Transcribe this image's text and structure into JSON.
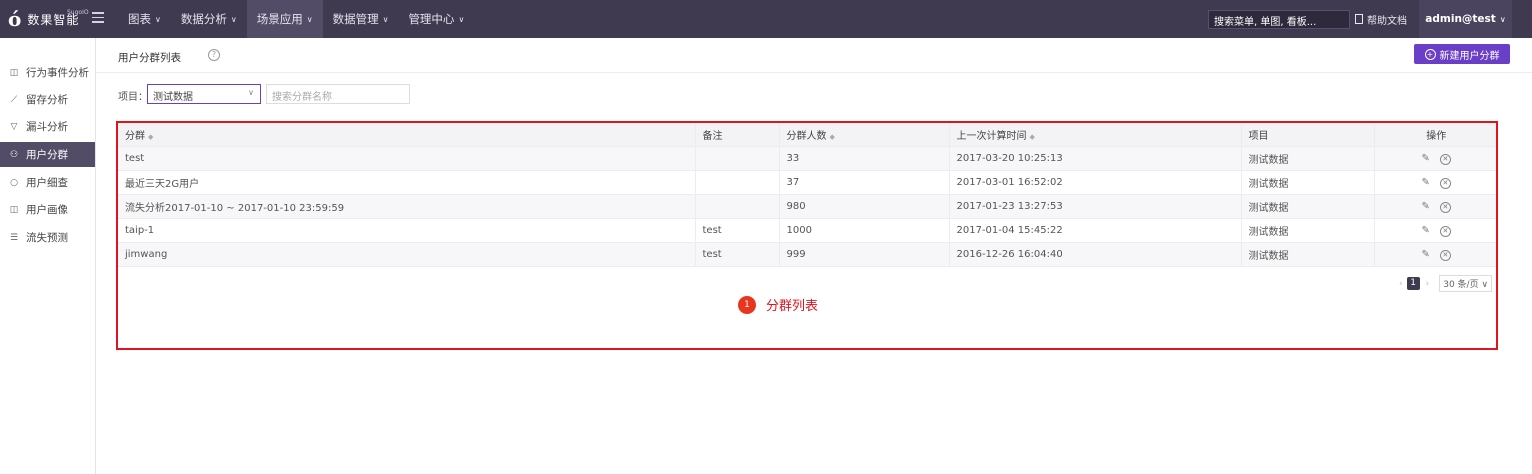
{
  "brand": {
    "mark": "ó",
    "name": "数果智能",
    "sup": "SugoIO"
  },
  "nav": {
    "items": [
      {
        "label": "图表",
        "active": false
      },
      {
        "label": "数据分析",
        "active": false
      },
      {
        "label": "场景应用",
        "active": true
      },
      {
        "label": "数据管理",
        "active": false
      },
      {
        "label": "管理中心",
        "active": false
      }
    ]
  },
  "header": {
    "search_placeholder": "搜索菜单, 单图, 看板...",
    "help": "帮助文档",
    "user": "admin@test"
  },
  "sidebar": {
    "items": [
      {
        "label": "行为事件分析",
        "icon": "event-icon",
        "glyph": "◫"
      },
      {
        "label": "留存分析",
        "icon": "chart-icon",
        "glyph": "⟋"
      },
      {
        "label": "漏斗分析",
        "icon": "funnel-icon",
        "glyph": "▽"
      },
      {
        "label": "用户分群",
        "icon": "users-icon",
        "glyph": "⚇",
        "active": true
      },
      {
        "label": "用户细查",
        "icon": "search-icon",
        "glyph": "○"
      },
      {
        "label": "用户画像",
        "icon": "portrait-icon",
        "glyph": "◫"
      },
      {
        "label": "流失预测",
        "icon": "list-icon",
        "glyph": "☰"
      }
    ]
  },
  "page": {
    "title": "用户分群列表",
    "help": "?",
    "new_button": "新建用户分群"
  },
  "filter": {
    "label": "项目：",
    "project_value": "测试数据",
    "name_placeholder": "搜索分群名称"
  },
  "table": {
    "headers": [
      "分群",
      "备注",
      "分群人数",
      "上一次计算时间",
      "项目",
      "操作"
    ],
    "rows": [
      {
        "name": "test",
        "note": "",
        "count": "33",
        "time": "2017-03-20 10:25:13",
        "project": "测试数据"
      },
      {
        "name": "最近三天2G用户",
        "note": "",
        "count": "37",
        "time": "2017-03-01 16:52:02",
        "project": "测试数据"
      },
      {
        "name": "流失分析2017-01-10 ~ 2017-01-10 23:59:59",
        "note": "",
        "count": "980",
        "time": "2017-01-23 13:27:53",
        "project": "测试数据"
      },
      {
        "name": "taip-1",
        "note": "test",
        "count": "1000",
        "time": "2017-01-04 15:45:22",
        "project": "测试数据"
      },
      {
        "name": "jimwang",
        "note": "test",
        "count": "999",
        "time": "2016-12-26 16:04:40",
        "project": "测试数据"
      }
    ]
  },
  "pager": {
    "prev": "‹",
    "current": "1",
    "next": "›",
    "page_size": "30 条/页"
  },
  "annotation": {
    "number": "1",
    "label": "分群列表"
  },
  "colors": {
    "topbar": "#3f3a50",
    "accent": "#6a3ec7",
    "annotation": "#e0141e"
  }
}
